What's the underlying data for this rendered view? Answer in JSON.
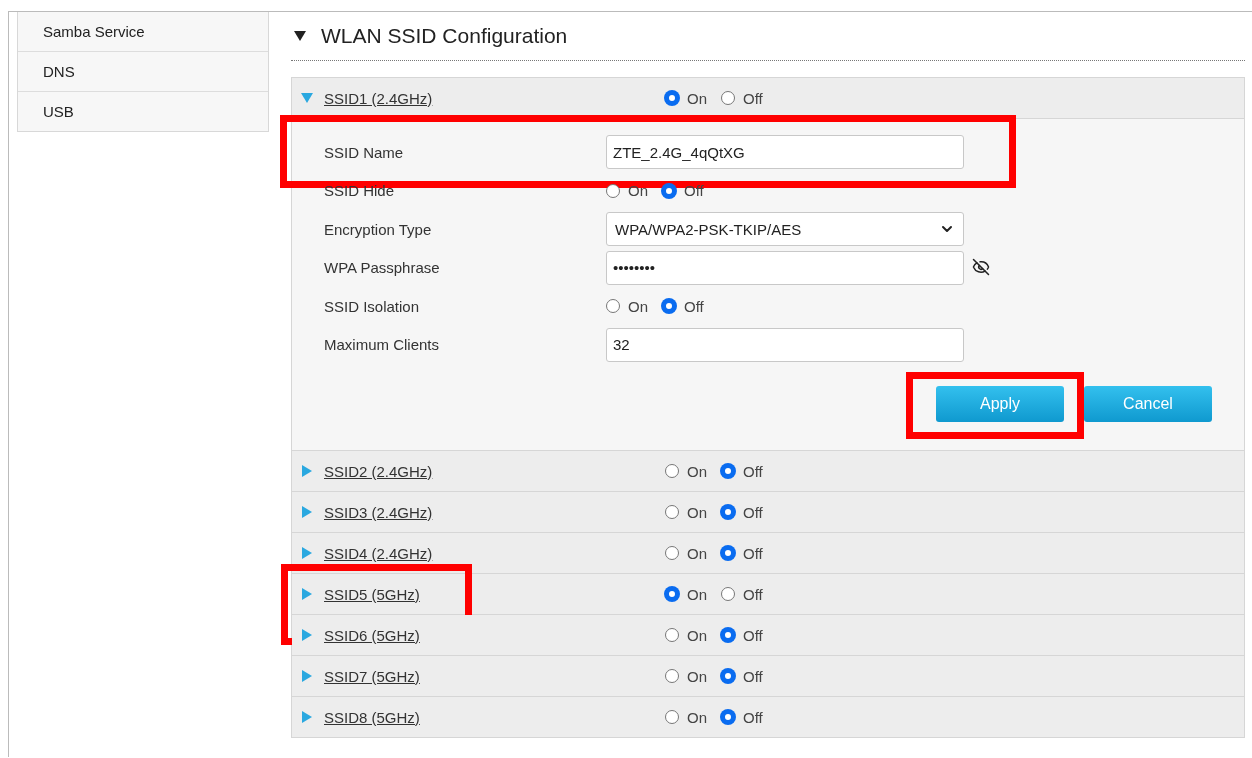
{
  "sidebar": {
    "items": [
      {
        "label": "Samba Service"
      },
      {
        "label": "DNS"
      },
      {
        "label": "USB"
      }
    ]
  },
  "section": {
    "title": "WLAN SSID Configuration",
    "expanded": true
  },
  "ssids": [
    {
      "name": "SSID1 (2.4GHz)",
      "expanded": true,
      "highlighted": false,
      "options": [
        {
          "label": "On",
          "selected": true
        },
        {
          "label": "Off",
          "selected": false
        }
      ],
      "settings": [
        {
          "kind": "text",
          "label": "SSID Name",
          "value": "ZTE_2.4G_4qQtXG",
          "highlighted": true
        },
        {
          "kind": "radio",
          "label": "SSID Hide",
          "highlighted": false,
          "options": [
            {
              "label": "On",
              "selected": false
            },
            {
              "label": "Off",
              "selected": true
            }
          ]
        },
        {
          "kind": "select",
          "label": "Encryption Type",
          "value": "WPA/WPA2-PSK-TKIP/AES",
          "highlighted": false
        },
        {
          "kind": "password",
          "label": "WPA Passphrase",
          "value": "••••••••",
          "highlighted": false
        },
        {
          "kind": "radio",
          "label": "SSID Isolation",
          "highlighted": false,
          "options": [
            {
              "label": "On",
              "selected": false
            },
            {
              "label": "Off",
              "selected": true
            }
          ]
        },
        {
          "kind": "text",
          "label": "Maximum Clients",
          "value": "32",
          "highlighted": false
        }
      ],
      "buttons": [
        {
          "label": "Apply",
          "highlighted": true
        },
        {
          "label": "Cancel",
          "highlighted": false
        }
      ]
    },
    {
      "name": "SSID2 (2.4GHz)",
      "expanded": false,
      "highlighted": false,
      "options": [
        {
          "label": "On",
          "selected": false
        },
        {
          "label": "Off",
          "selected": true
        }
      ]
    },
    {
      "name": "SSID3 (2.4GHz)",
      "expanded": false,
      "highlighted": false,
      "options": [
        {
          "label": "On",
          "selected": false
        },
        {
          "label": "Off",
          "selected": true
        }
      ]
    },
    {
      "name": "SSID4 (2.4GHz)",
      "expanded": false,
      "highlighted": false,
      "options": [
        {
          "label": "On",
          "selected": false
        },
        {
          "label": "Off",
          "selected": true
        }
      ]
    },
    {
      "name": "SSID5 (5GHz)",
      "expanded": false,
      "highlighted": true,
      "options": [
        {
          "label": "On",
          "selected": true
        },
        {
          "label": "Off",
          "selected": false
        }
      ]
    },
    {
      "name": "SSID6 (5GHz)",
      "expanded": false,
      "highlighted": false,
      "options": [
        {
          "label": "On",
          "selected": false
        },
        {
          "label": "Off",
          "selected": true
        }
      ]
    },
    {
      "name": "SSID7 (5GHz)",
      "expanded": false,
      "highlighted": false,
      "options": [
        {
          "label": "On",
          "selected": false
        },
        {
          "label": "Off",
          "selected": true
        }
      ]
    },
    {
      "name": "SSID8 (5GHz)",
      "expanded": false,
      "highlighted": false,
      "options": [
        {
          "label": "On",
          "selected": false
        },
        {
          "label": "Off",
          "selected": true
        }
      ]
    }
  ]
}
